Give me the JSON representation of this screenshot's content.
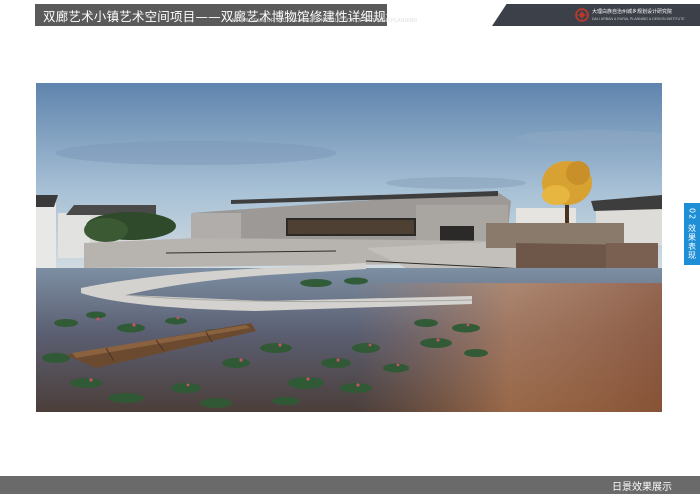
{
  "header": {
    "title": "双廊艺术小镇艺术空间项目——双廊艺术博物馆修建性详细规划",
    "subtitle_en": "ART MUSEUM OF SHUANGLANG CONSTRUCTION OF DETAILED PLANNING"
  },
  "logo": {
    "name_cn": "大理白族自治州城乡规划设计研究院",
    "name_en": "DALI URBAN & RURAL PLANNING & DESIGN INSTITUTE",
    "icon": "institute-logo-icon",
    "accent": "#c0392b"
  },
  "side_tab": {
    "label": "02 效果表现",
    "color": "#1e8fd6"
  },
  "footer": {
    "label": "日景效果展示"
  },
  "render": {
    "icon": "architectural-render-image"
  }
}
